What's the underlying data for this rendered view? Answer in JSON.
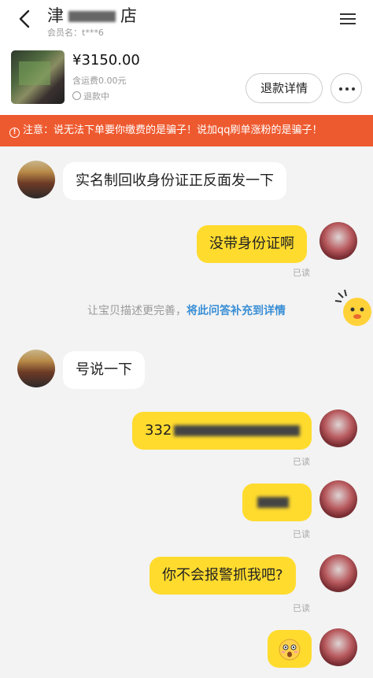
{
  "header": {
    "shop_prefix": "津",
    "shop_suffix": "店",
    "member_label": "会员名：t***6"
  },
  "product": {
    "price": "¥3150.00",
    "shipping": "含运费0.00元",
    "status": "退款中",
    "refund_button": "退款详情"
  },
  "warning": "注意：说无法下单要你缴费的是骗子！说加qq刷单涨粉的是骗子！",
  "messages": [
    {
      "side": "left",
      "text": "实名制回收身份证正反面发一下"
    },
    {
      "side": "right",
      "text": "没带身份证啊",
      "status": "已读"
    },
    {
      "side": "left",
      "text": "号说一下"
    },
    {
      "side": "right",
      "text": "332",
      "status": "已读"
    },
    {
      "side": "right",
      "text": "",
      "status": "已读"
    },
    {
      "side": "right",
      "text": "你不会报警抓我吧?",
      "status": "已读"
    },
    {
      "side": "right",
      "emoji": "surprised-emoji"
    }
  ],
  "system_notice": {
    "text": "让宝贝描述更完善，",
    "link": "将此问答补充到详情"
  },
  "colors": {
    "warning_bg": "#ee5a2f",
    "bubble_mine": "#ffdb2e",
    "link": "#3a8fd6"
  }
}
